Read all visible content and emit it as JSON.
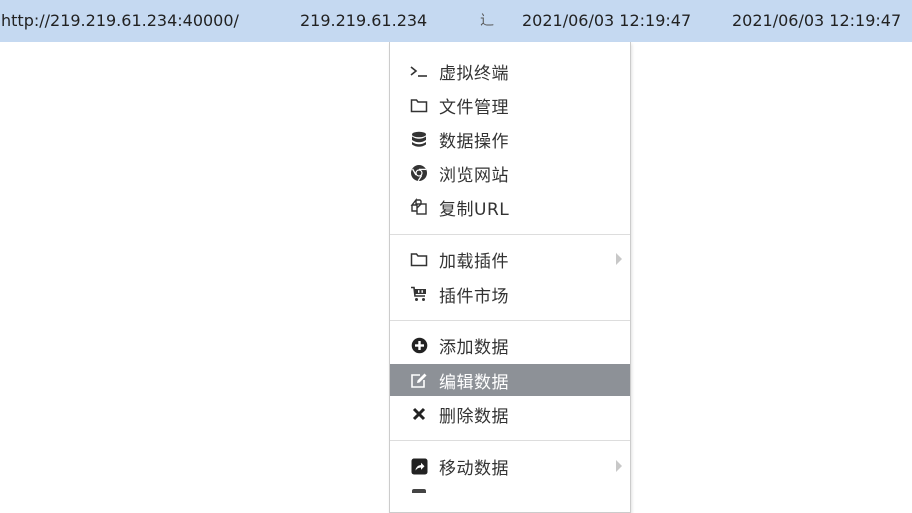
{
  "row": {
    "url": "http://219.219.61.234:40000/",
    "ip": "219.219.61.234",
    "location_glyph": "辶",
    "created": "2021/06/03 12:19:47",
    "updated": "2021/06/03 12:19:47"
  },
  "context_menu": {
    "items": [
      {
        "label": "虚拟终端",
        "icon": "terminal-icon"
      },
      {
        "label": "文件管理",
        "icon": "folder-icon"
      },
      {
        "label": "数据操作",
        "icon": "database-icon"
      },
      {
        "label": "浏览网站",
        "icon": "chrome-icon"
      },
      {
        "label": "复制URL",
        "icon": "copy-icon"
      },
      {
        "label": "加载插件",
        "icon": "folder-icon",
        "submenu": true
      },
      {
        "label": "插件市场",
        "icon": "cart-icon"
      },
      {
        "label": "添加数据",
        "icon": "plus-circle-icon"
      },
      {
        "label": "编辑数据",
        "icon": "edit-icon",
        "active": true
      },
      {
        "label": "删除数据",
        "icon": "close-icon"
      },
      {
        "label": "移动数据",
        "icon": "share-square-icon",
        "submenu": true
      }
    ]
  },
  "colors": {
    "row_highlight": "#c5d9f1",
    "active_item": "#8d9197"
  }
}
